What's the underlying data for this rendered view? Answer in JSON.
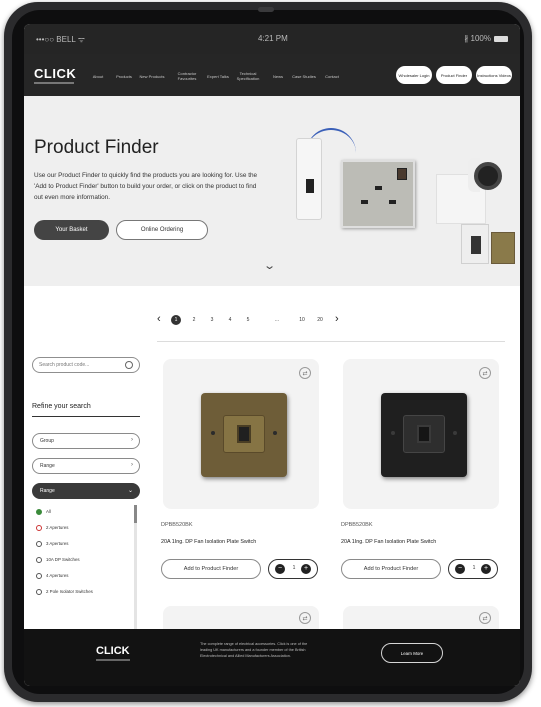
{
  "status_bar": {
    "carrier": "•••○○ BELL ᯤ",
    "time": "4:21 PM",
    "battery": "∦ 100%"
  },
  "nav": {
    "logo": "CLICK",
    "links": [
      "About",
      "Products",
      "New Products",
      "Contractor Favourites",
      "Expert Talks",
      "Technical Specification",
      "News",
      "Case Studies",
      "Contact"
    ],
    "pills": [
      "Wholesaler Login",
      "Product Finder",
      "Instructions Videos"
    ]
  },
  "hero": {
    "title": "Product Finder",
    "text": "Use our Product Finder to quickly find the products you are looking for. Use the 'Add to Product Finder' button to build your order, or click on the product to find out even more information.",
    "basket_label": "Your Basket",
    "online_label": "Online Ordering"
  },
  "pagination": {
    "prev": "‹",
    "next": "›",
    "pages": [
      "1",
      "2",
      "3",
      "4",
      "5",
      "...",
      "10",
      "20"
    ],
    "active_index": 0
  },
  "sidebar": {
    "search_placeholder": "Search product code...",
    "refine_title": "Refine your search",
    "filters": [
      {
        "label": "Group",
        "open": false
      },
      {
        "label": "Range",
        "open": false
      },
      {
        "label": "Range",
        "open": true
      }
    ],
    "options": [
      "All",
      "2 Apertures",
      "3 Apertures",
      "10A DP Switches",
      "4 Apertures",
      "2 Pole Isolator Switches"
    ]
  },
  "products": [
    {
      "sku": "DPBB520BK",
      "name": "20A 1Ing. DP Fan Isolation Plate Switch",
      "add_label": "Add to Product Finder",
      "qty": "1",
      "finish": "brass"
    },
    {
      "sku": "DPBB520BK",
      "name": "20A 1Ing. DP Fan Isolation Plate Switch",
      "add_label": "Add to Product Finder",
      "qty": "1",
      "finish": "black"
    }
  ],
  "footer": {
    "logo": "CLICK",
    "text": "The complete range of electrical accessories. Click is one of the leading UK manufacturers and a founder member of the British Electrotechnical and Allied Manufacturers Association.",
    "button_label": "Learn More"
  },
  "colors": {
    "nav_bg": "#262626",
    "hero_bg": "#efefef",
    "footer_bg": "#121212",
    "active_page": "#333333"
  }
}
